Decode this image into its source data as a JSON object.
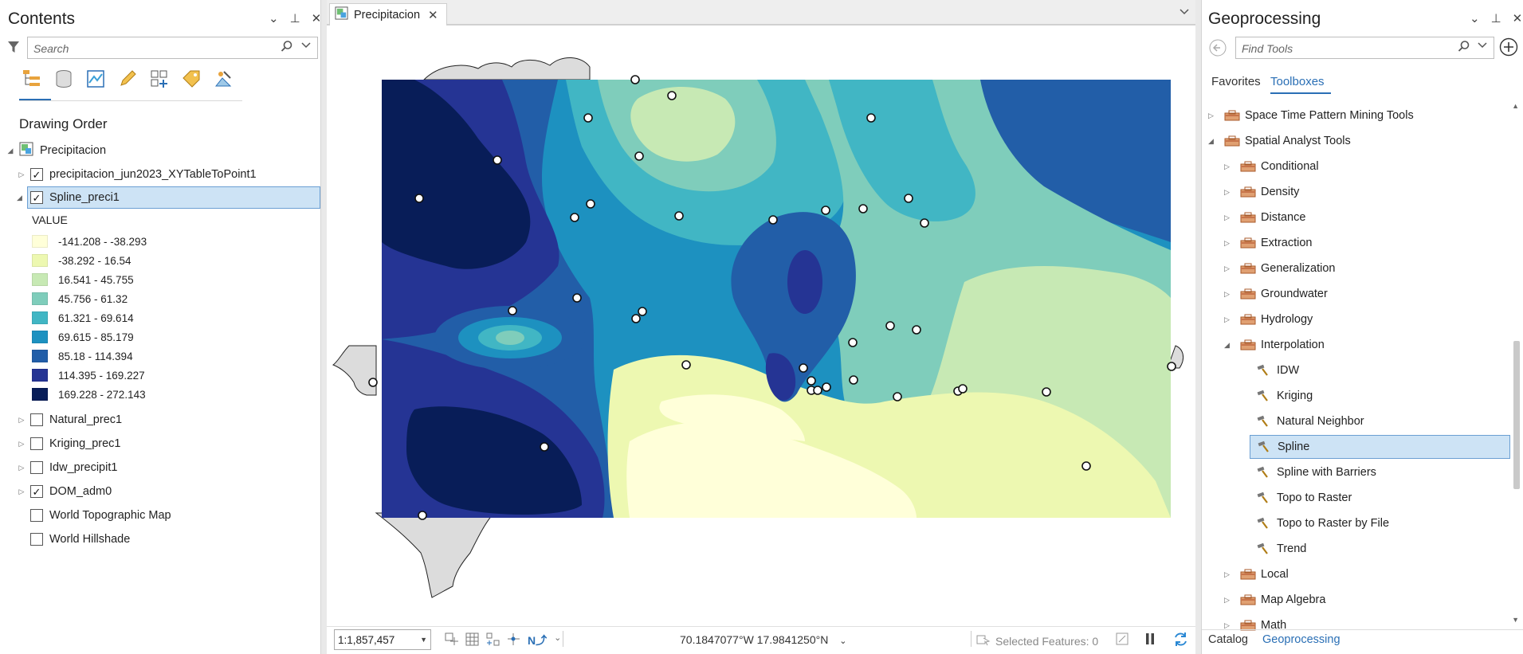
{
  "contents": {
    "title": "Contents",
    "search_placeholder": "Search",
    "section_label": "Drawing Order",
    "map_name": "Precipitacion",
    "layers": [
      {
        "name": "precipitacion_jun2023_XYTableToPoint1",
        "checked": true
      },
      {
        "name": "Spline_preci1",
        "checked": true
      }
    ],
    "legend_header": "VALUE",
    "legend": [
      {
        "label": "-141.208 - -38.293",
        "color": "#ffffd9"
      },
      {
        "label": "-38.292 - 16.54",
        "color": "#edf8b1"
      },
      {
        "label": "16.541 - 45.755",
        "color": "#c7e9b4"
      },
      {
        "label": "45.756 - 61.32",
        "color": "#7fcdbb"
      },
      {
        "label": "61.321 - 69.614",
        "color": "#41b6c4"
      },
      {
        "label": "69.615 - 85.179",
        "color": "#1d91c0"
      },
      {
        "label": "85.18 - 114.394",
        "color": "#225ea8"
      },
      {
        "label": "114.395 - 169.227",
        "color": "#253494"
      },
      {
        "label": "169.228 - 272.143",
        "color": "#081d58"
      }
    ],
    "other_layers": [
      {
        "name": "Natural_prec1",
        "checked": false,
        "expander": true
      },
      {
        "name": "Kriging_prec1",
        "checked": false,
        "expander": true
      },
      {
        "name": "Idw_precipit1",
        "checked": false,
        "expander": true
      },
      {
        "name": "DOM_adm0",
        "checked": true,
        "expander": true
      },
      {
        "name": "World Topographic Map",
        "checked": false,
        "expander": false
      },
      {
        "name": "World Hillshade",
        "checked": false,
        "expander": false
      }
    ]
  },
  "map": {
    "tab_label": "Precipitacion",
    "scale": "1:1,857,457",
    "coordinates": "70.1847077°W 17.9841250°N",
    "selected_features": "Selected Features: 0"
  },
  "geoprocessing": {
    "title": "Geoprocessing",
    "search_placeholder": "Find Tools",
    "tabs": [
      "Favorites",
      "Toolboxes"
    ],
    "active_tab": "Toolboxes",
    "toolboxes_top": [
      {
        "label": "Space Time Pattern Mining Tools",
        "expanded": false
      },
      {
        "label": "Spatial Analyst Tools",
        "expanded": true
      }
    ],
    "spatial_children": [
      "Conditional",
      "Density",
      "Distance",
      "Extraction",
      "Generalization",
      "Groundwater",
      "Hydrology"
    ],
    "interpolation_label": "Interpolation",
    "interpolation_tools": [
      "IDW",
      "Kriging",
      "Natural Neighbor",
      "Spline",
      "Spline with Barriers",
      "Topo to Raster",
      "Topo to Raster by File",
      "Trend"
    ],
    "selected_tool": "Spline",
    "after_children": [
      "Local",
      "Map Algebra",
      "Math"
    ]
  },
  "bottom_tabs": [
    "Catalog",
    "Geoprocessing"
  ],
  "icons": {
    "filter": "filter-icon",
    "search": "search-icon",
    "pin": "pin-icon",
    "close": "close-icon",
    "dropdown": "chevron-down-icon",
    "back": "back-icon",
    "add": "add-icon",
    "hammer": "hammer-icon",
    "toolbox": "toolbox-icon"
  }
}
